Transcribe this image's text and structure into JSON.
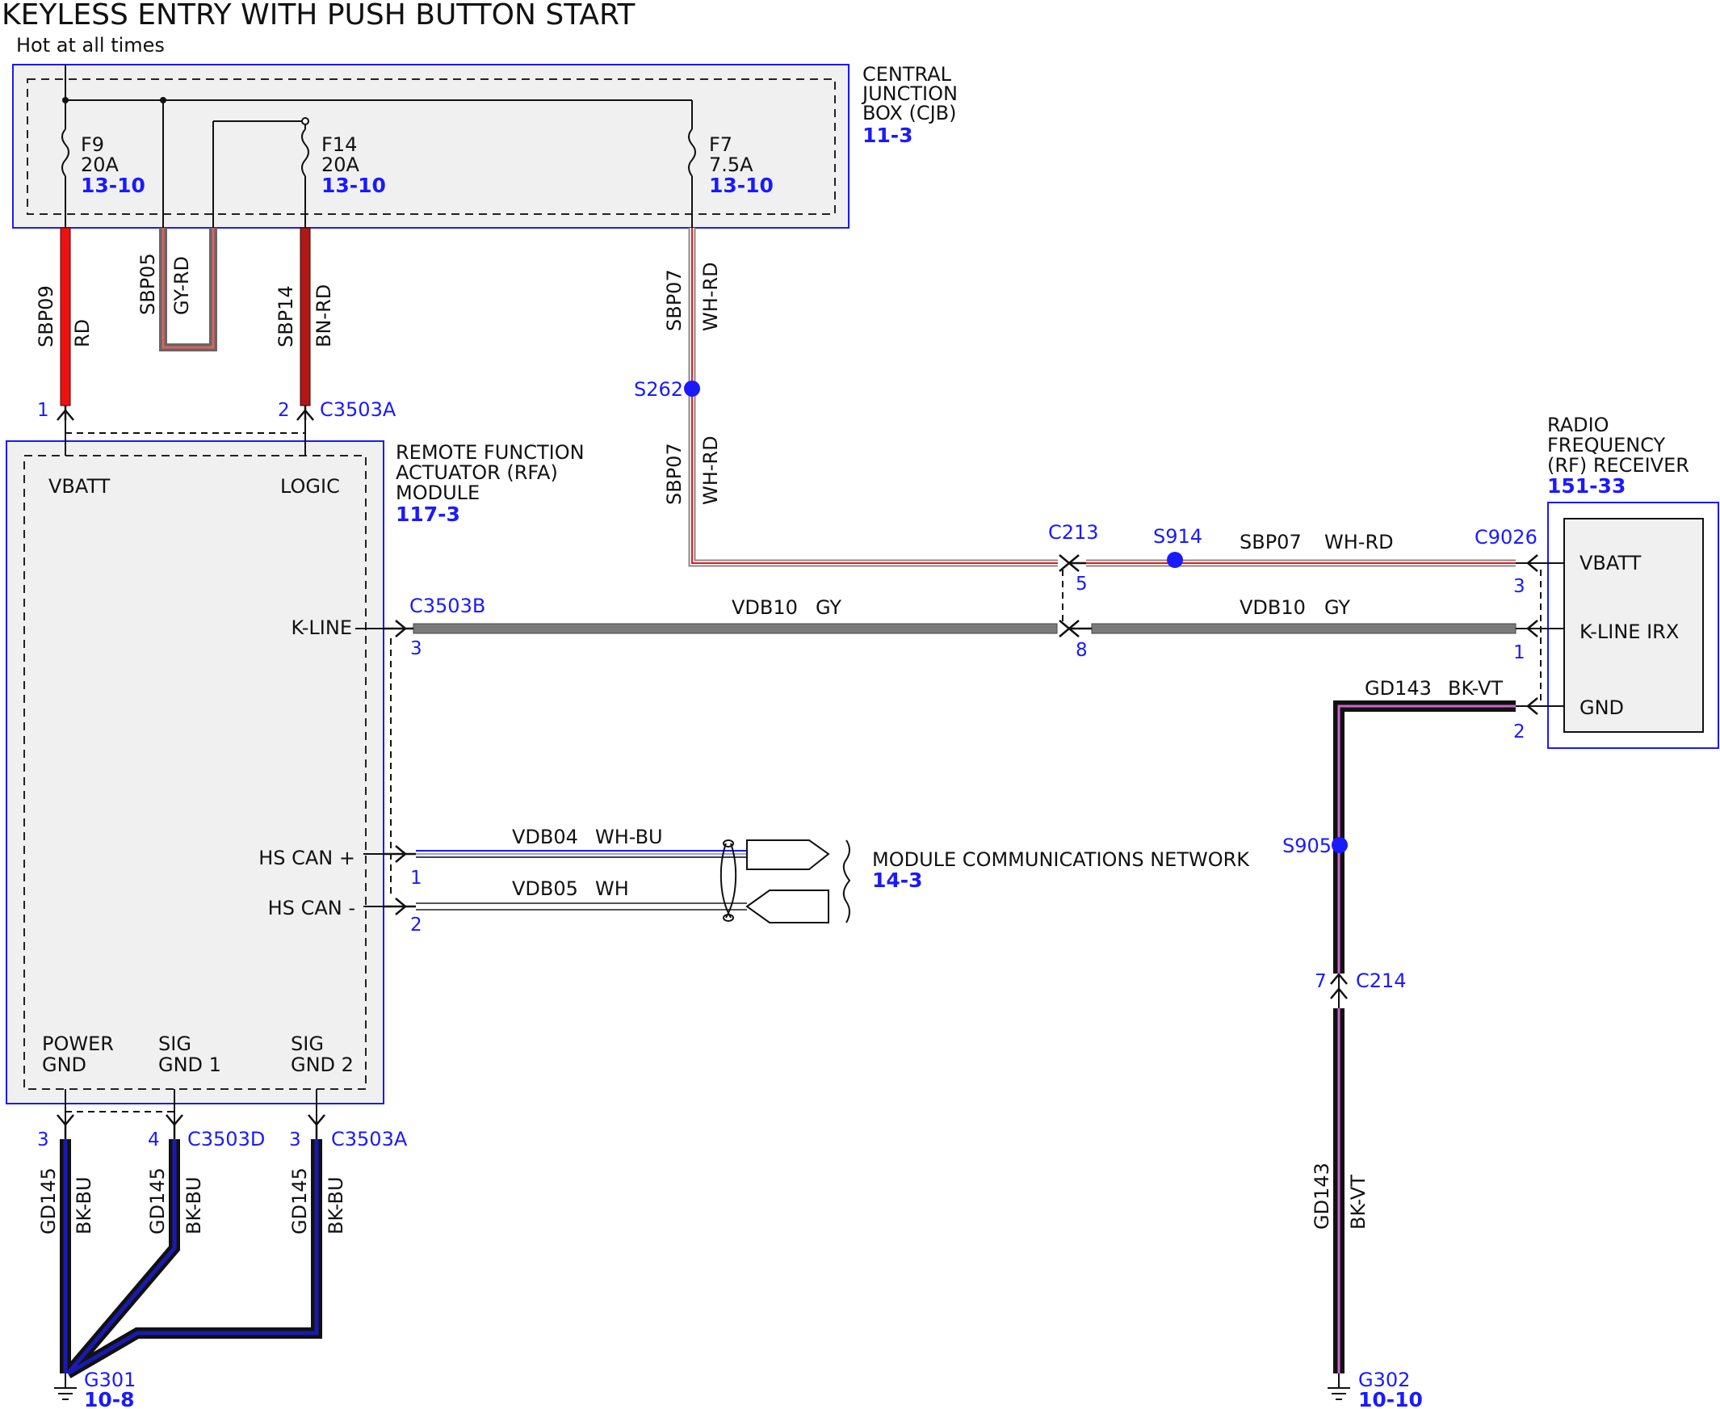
{
  "title": "KEYLESS ENTRY WITH PUSH BUTTON START",
  "hot_label": "Hot at all times",
  "colors": {
    "box_border": "#1a1aff",
    "box_fill": "#f0f0f0",
    "link_blue": "#1a1aff",
    "wire_red": "#ee1111",
    "wire_brown_red": "#b01818",
    "wire_gray": "#7a7a7a",
    "wire_black": "#111111",
    "wire_blue": "#1a1ab0",
    "wire_violet": "#cc66cc"
  },
  "cjb": {
    "name_line1": "CENTRAL",
    "name_line2": "JUNCTION",
    "name_line3": "BOX (CJB)",
    "ref": "11-3",
    "fuses": [
      {
        "name": "F9",
        "rating": "20A",
        "ref": "13-10"
      },
      {
        "name": "F14",
        "rating": "20A",
        "ref": "13-10"
      },
      {
        "name": "F7",
        "rating": "7.5A",
        "ref": "13-10"
      }
    ]
  },
  "rfa": {
    "name_line1": "REMOTE FUNCTION",
    "name_line2": "ACTUATOR (RFA)",
    "name_line3": "MODULE",
    "ref": "117-3",
    "pins": {
      "vbatt": "VBATT",
      "logic": "LOGIC",
      "kline": "K-LINE",
      "hscan_plus": "HS CAN +",
      "hscan_minus": "HS CAN -",
      "power_gnd_1": "POWER",
      "power_gnd_2": "GND",
      "sig_gnd1_1": "SIG",
      "sig_gnd1_2": "GND 1",
      "sig_gnd2_1": "SIG",
      "sig_gnd2_2": "GND 2"
    }
  },
  "rf": {
    "name_line1": "RADIO",
    "name_line2": "FREQUENCY",
    "name_line3": "(RF) RECEIVER",
    "ref": "151-33",
    "pins": {
      "vbatt": "VBATT",
      "kline": "K-LINE IRX",
      "gnd": "GND"
    }
  },
  "network": {
    "label": "MODULE COMMUNICATIONS NETWORK",
    "ref": "14-3"
  },
  "wires": {
    "sbp09": {
      "circuit": "SBP09",
      "color": "RD"
    },
    "sbp05": {
      "circuit": "SBP05",
      "color": "GY-RD"
    },
    "sbp14": {
      "circuit": "SBP14",
      "color": "BN-RD"
    },
    "sbp07_top": {
      "circuit": "SBP07",
      "color": "WH-RD"
    },
    "sbp07_mid": {
      "circuit": "SBP07",
      "color": "WH-RD"
    },
    "sbp07_h": {
      "circuit": "SBP07",
      "color": "WH-RD"
    },
    "vdb10_a": {
      "circuit": "VDB10",
      "color": "GY"
    },
    "vdb10_b": {
      "circuit": "VDB10",
      "color": "GY"
    },
    "vdb04": {
      "circuit": "VDB04",
      "color": "WH-BU"
    },
    "vdb05": {
      "circuit": "VDB05",
      "color": "WH"
    },
    "gd143_h": {
      "circuit": "GD143",
      "color": "BK-VT"
    },
    "gd143_v": {
      "circuit": "GD143",
      "color": "BK-VT"
    },
    "gd145_a": {
      "circuit": "GD145",
      "color": "BK-BU"
    },
    "gd145_b": {
      "circuit": "GD145",
      "color": "BK-BU"
    },
    "gd145_c": {
      "circuit": "GD145",
      "color": "BK-BU"
    }
  },
  "connectors": {
    "c3503a_top": {
      "name": "C3503A",
      "pin_vbatt": "1",
      "pin_logic": "2"
    },
    "c3503b": {
      "name": "C3503B",
      "pin_kline": "3",
      "pin_canp": "1",
      "pin_canm": "2"
    },
    "c213": {
      "name": "C213",
      "pin_vbatt": "5",
      "pin_kline": "8"
    },
    "c9026": {
      "name": "C9026",
      "pin_vbatt": "3",
      "pin_kline": "1",
      "pin_gnd": "2"
    },
    "c3503d": {
      "name": "C3503D",
      "pin_power": "3",
      "pin_sig1": "4"
    },
    "c3503a_bot": {
      "name": "C3503A",
      "pin_sig2": "3"
    },
    "c214": {
      "name": "C214",
      "pin": "7"
    }
  },
  "splices": {
    "s262": "S262",
    "s914": "S914",
    "s905": "S905"
  },
  "grounds": {
    "g301": {
      "name": "G301",
      "ref": "10-8"
    },
    "g302": {
      "name": "G302",
      "ref": "10-10"
    }
  }
}
